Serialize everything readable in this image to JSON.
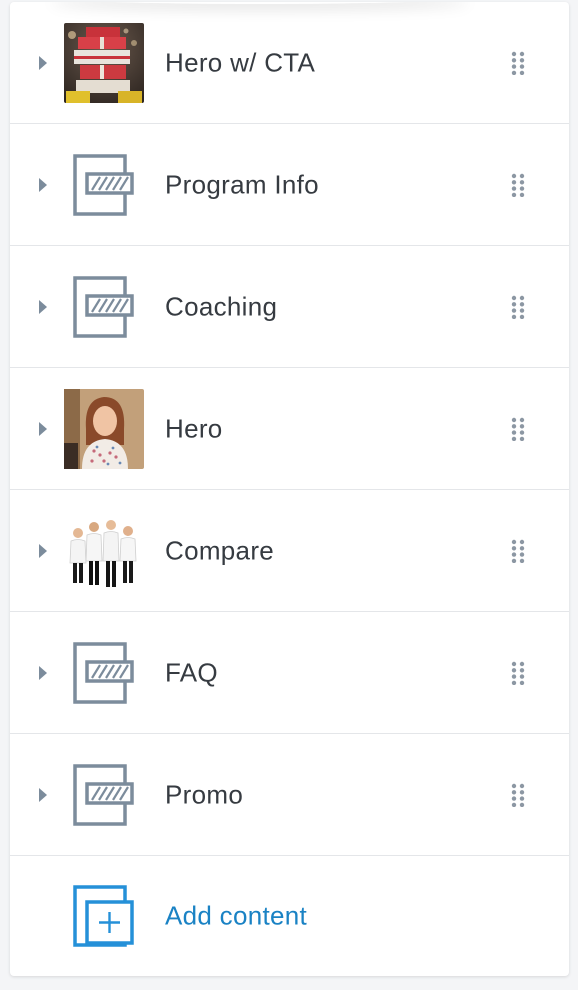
{
  "items": [
    {
      "label": "Hero w/ CTA",
      "thumb": "gifts-photo"
    },
    {
      "label": "Program Info",
      "thumb": "section-icon"
    },
    {
      "label": "Coaching",
      "thumb": "section-icon"
    },
    {
      "label": "Hero",
      "thumb": "woman-photo"
    },
    {
      "label": "Compare",
      "thumb": "doctors-photo"
    },
    {
      "label": "FAQ",
      "thumb": "section-icon"
    },
    {
      "label": "Promo",
      "thumb": "section-icon"
    }
  ],
  "add_content": {
    "label": "Add content",
    "icon": "add-section-icon"
  },
  "colors": {
    "text": "#363b41",
    "link": "#1a82c4",
    "icon": "#7c8c9c",
    "divider": "#e4e6e9"
  }
}
